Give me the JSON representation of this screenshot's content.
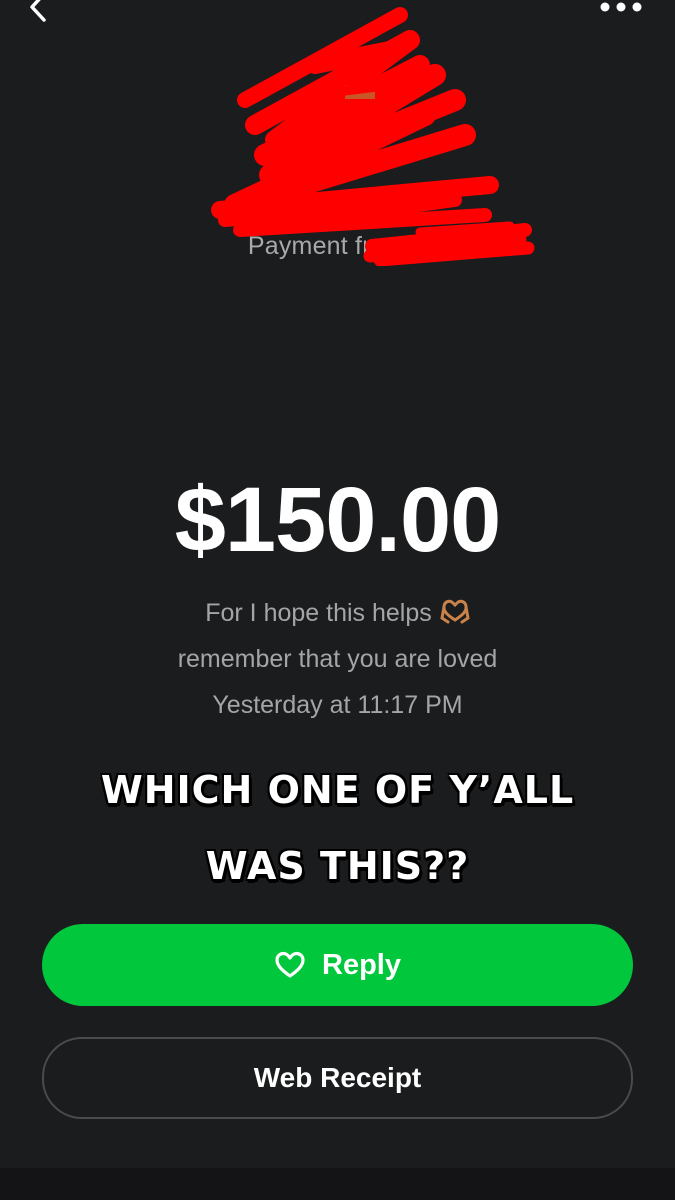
{
  "header": {
    "back_icon": "chevron-left-icon",
    "more_icon": "more-dots-icon"
  },
  "payment": {
    "subtitle": "Payment from $",
    "amount": "$150.00",
    "note_line1": "For I hope this helps",
    "note_emoji": "heart-hands-emoji",
    "note_line2": "remember that you are loved",
    "timestamp": "Yesterday at 11:17 PM"
  },
  "overlay": {
    "line1": "WHICH ONE OF Y’ALL",
    "line2": "WAS THIS??"
  },
  "actions": {
    "reply_label": "Reply",
    "reply_icon": "heart-outline-icon",
    "receipt_label": "Web Receipt"
  },
  "colors": {
    "background": "#1b1c1e",
    "accent_green": "#00c73c",
    "redaction_red": "#ff0000",
    "muted_text": "#a8a9ab"
  }
}
